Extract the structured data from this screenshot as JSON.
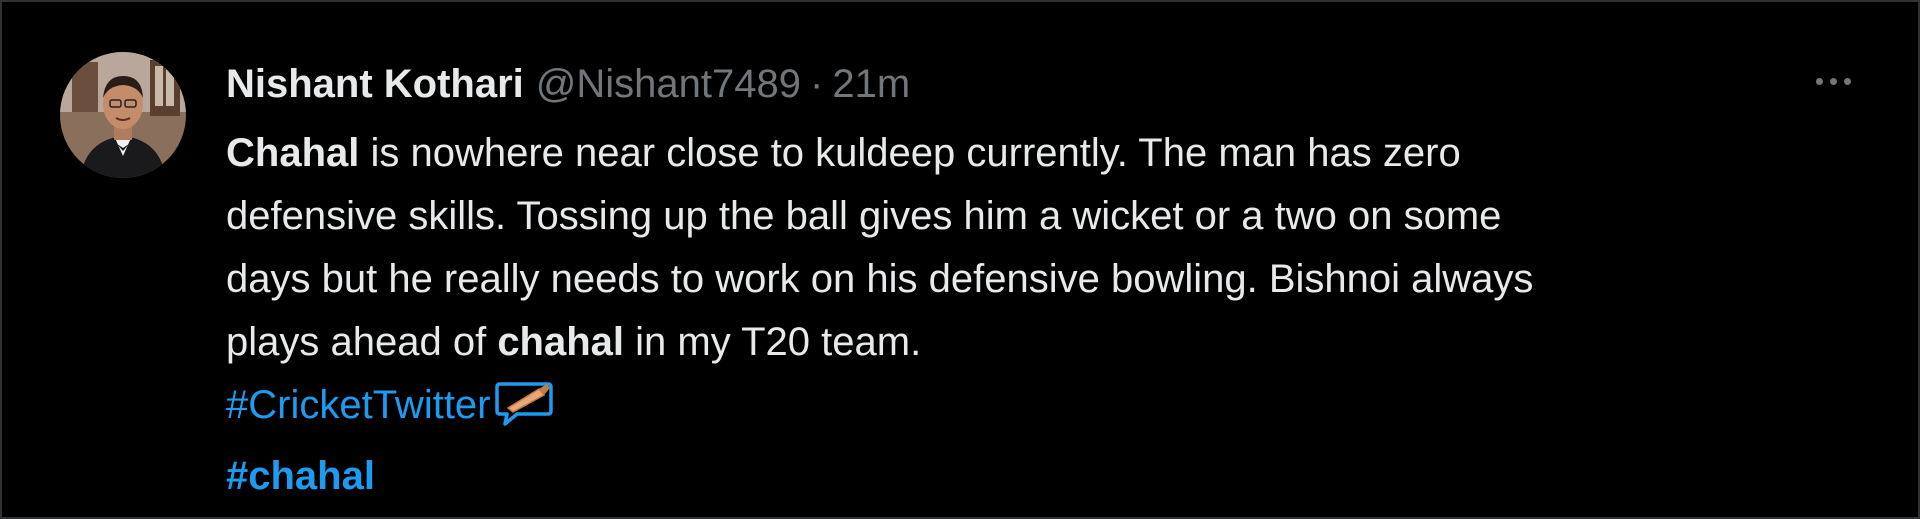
{
  "tweet": {
    "author_name": "Nishant Kothari",
    "handle": "@Nishant7489",
    "separator": "·",
    "time": "21m",
    "more_icon": "more-horizontal-icon",
    "avatar_icon": "avatar-photo",
    "body": {
      "line1_bold": "Chahal",
      "line1_rest": " is nowhere near close to kuldeep currently. The man has zero",
      "line2": "defensive skills. Tossing up the ball gives him a wicket or a two on some",
      "line3": "days but he really needs to work on his defensive bowling. Bishnoi always",
      "line4_pre": "plays ahead of ",
      "line4_bold": "chahal",
      "line4_post": " in my T20 team."
    },
    "hashtags": {
      "cricket_twitter": "#CricketTwitter",
      "cricket_emoji_icon": "cricket-bat-speech-bubble-icon",
      "chahal": "#chahal"
    },
    "colors": {
      "background": "#000000",
      "text": "#e7e9ea",
      "secondary": "#71767b",
      "link": "#1d9bf0",
      "border": "#2f3336"
    }
  }
}
